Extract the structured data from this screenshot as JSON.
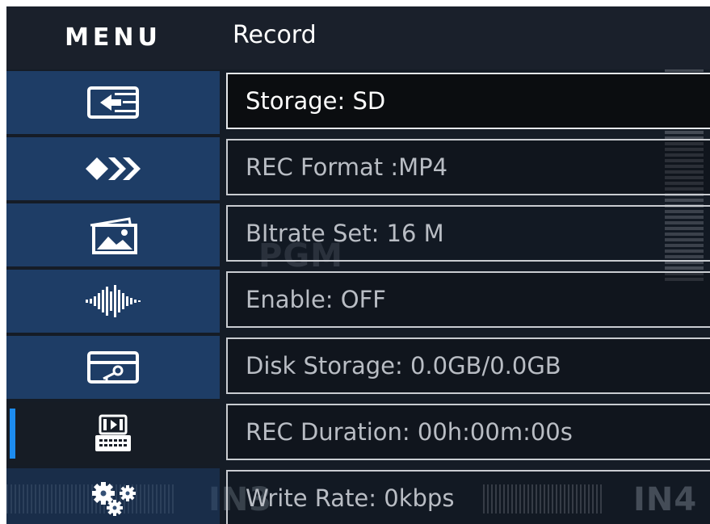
{
  "header": {
    "menu_title": "MENU",
    "section_title": "Record"
  },
  "background": {
    "pgm_label": "PGM",
    "in3_label": "IN3",
    "in4_label": "IN4"
  },
  "sidebar": {
    "items": [
      {
        "icon": "input-switch-icon",
        "active": false
      },
      {
        "icon": "transition-chevrons-icon",
        "active": false
      },
      {
        "icon": "picture-gallery-icon",
        "active": false
      },
      {
        "icon": "audio-waveform-icon",
        "active": false
      },
      {
        "icon": "key-card-icon",
        "active": false
      },
      {
        "icon": "record-sd-icon",
        "active": true
      },
      {
        "icon": "settings-gears-icon",
        "active": false
      }
    ]
  },
  "settings": [
    {
      "label": "Storage: SD",
      "selected": true
    },
    {
      "label": "REC Format :MP4",
      "selected": false
    },
    {
      "label": "BItrate Set: 16 M",
      "selected": false
    },
    {
      "label": "Enable: OFF",
      "selected": false
    },
    {
      "label": "Disk Storage: 0.0GB/0.0GB",
      "selected": false
    },
    {
      "label": "REC Duration: 00h:00m:00s",
      "selected": false
    },
    {
      "label": "Write Rate: 0kbps",
      "selected": false
    }
  ],
  "colors": {
    "accent": "#1d8cf0",
    "sidebar_item": "#1e3d66",
    "panel_bg": "#151c26",
    "text": "#ffffff"
  }
}
